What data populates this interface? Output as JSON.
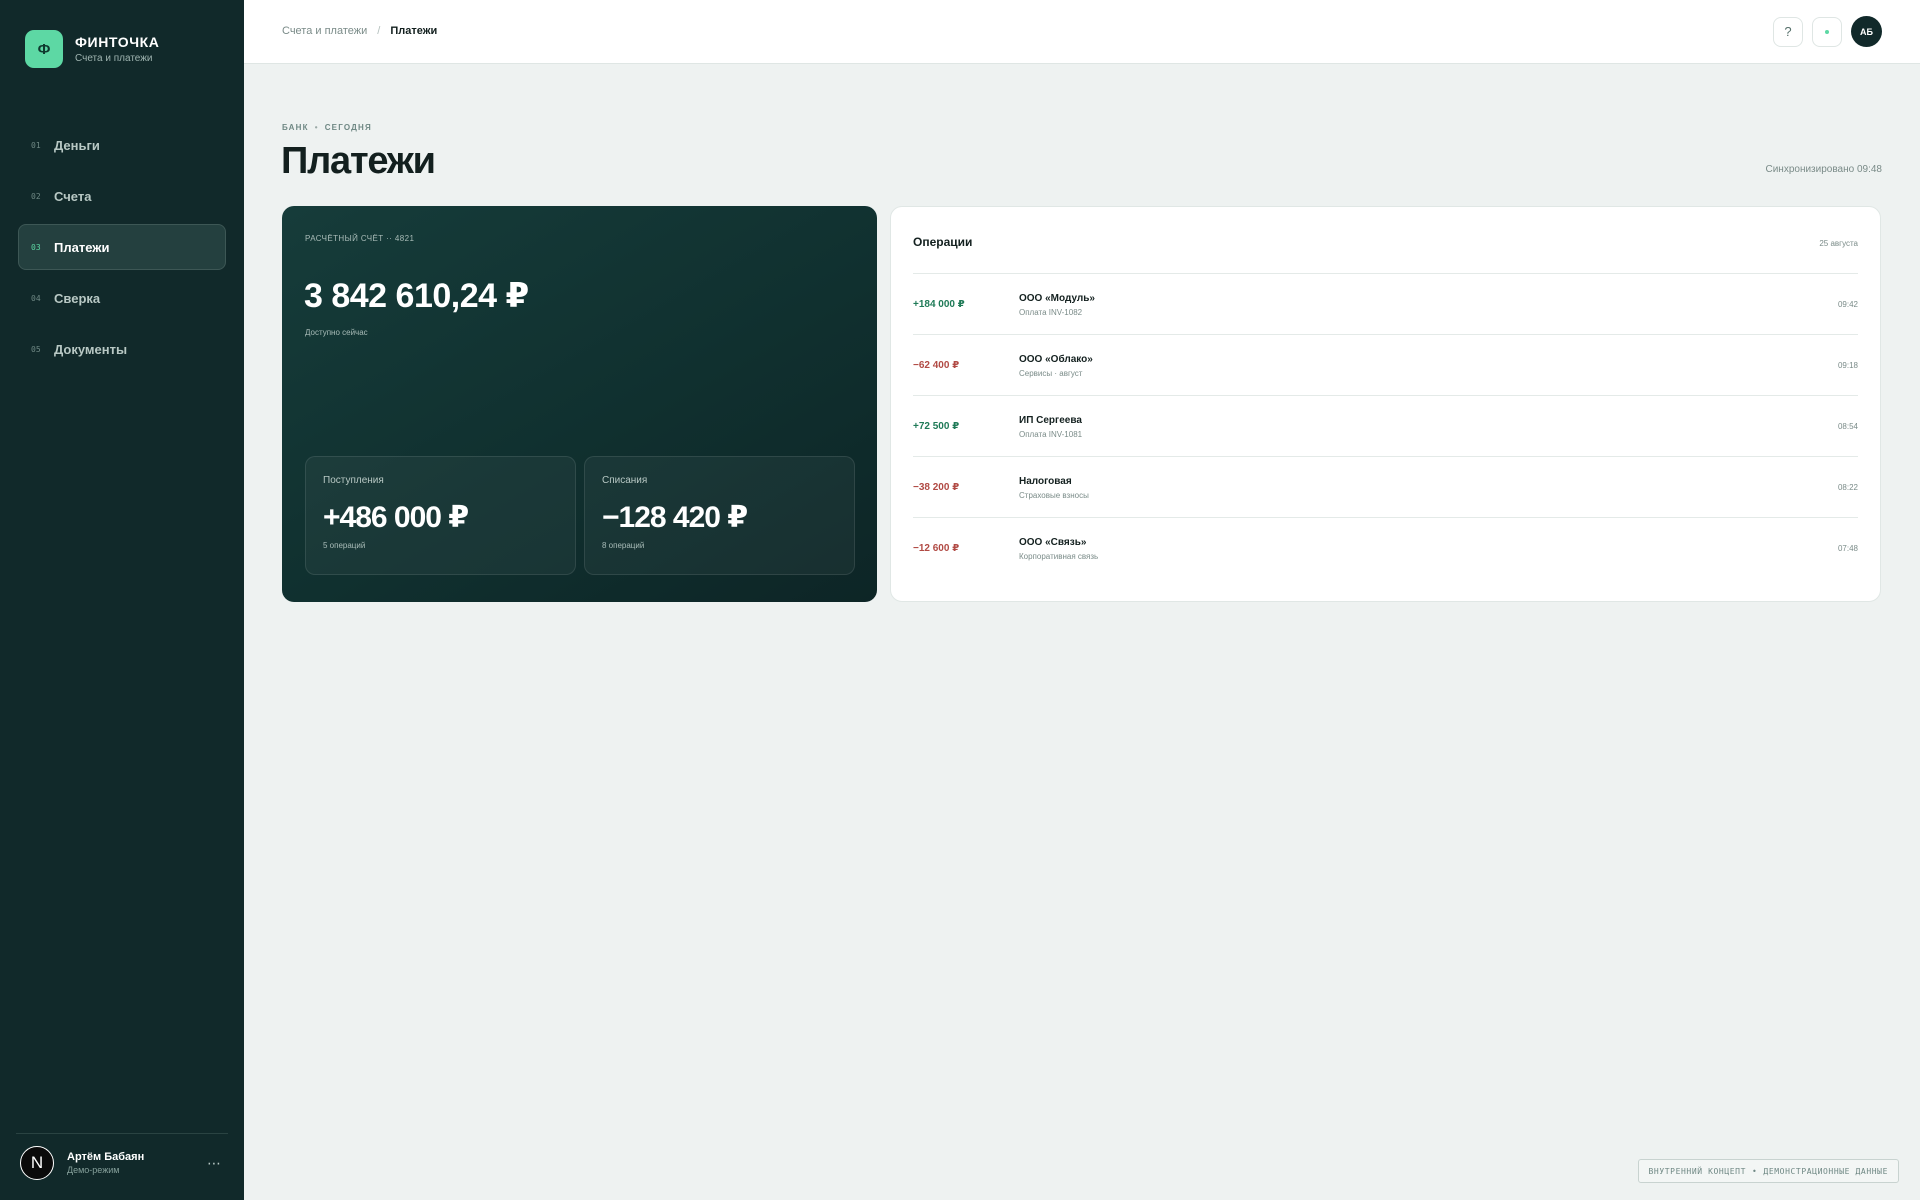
{
  "brand": {
    "logo_letter": "Ф",
    "name": "ФИНТОЧКА",
    "subtitle": "Счета и платежи"
  },
  "nav": {
    "items": [
      {
        "num": "01",
        "label": "Деньги",
        "active": false
      },
      {
        "num": "02",
        "label": "Счета",
        "active": false
      },
      {
        "num": "03",
        "label": "Платежи",
        "active": true
      },
      {
        "num": "04",
        "label": "Сверка",
        "active": false
      },
      {
        "num": "05",
        "label": "Документы",
        "active": false
      }
    ]
  },
  "user": {
    "avatar_letter": "N",
    "name": "Артём Бабаян",
    "role": "Демо-режим",
    "more": "⋯"
  },
  "topbar": {
    "breadcrumbs": [
      "Счета и платежи",
      "Платежи"
    ],
    "breadcrumb_sep": "/",
    "help_label": "?",
    "avatar_initials": "АБ"
  },
  "page": {
    "eyebrow": [
      "БАНК",
      "СЕГОДНЯ"
    ],
    "eyebrow_sep": "•",
    "title": "Платежи",
    "sync_status": "Синхронизировано 09:48"
  },
  "balance_card": {
    "account": "РАСЧЁТНЫЙ СЧЁТ ·· 4821",
    "amount": "3 842 610,24 ₽",
    "amount_caption": "Доступно сейчас",
    "income": {
      "label": "Поступления",
      "value": "+486 000 ₽",
      "count": "5 операций"
    },
    "expense": {
      "label": "Списания",
      "value": "−128 420 ₽",
      "count": "8 операций"
    }
  },
  "operations": {
    "title": "Операции",
    "date": "25 августа",
    "items": [
      {
        "amount": "+184 000 ₽",
        "direction": "in",
        "name": "ООО «Модуль»",
        "desc": "Оплата INV-1082",
        "time": "09:42"
      },
      {
        "amount": "−62 400 ₽",
        "direction": "out",
        "name": "ООО «Облако»",
        "desc": "Сервисы · август",
        "time": "09:18"
      },
      {
        "amount": "+72 500 ₽",
        "direction": "in",
        "name": "ИП Сергеева",
        "desc": "Оплата INV-1081",
        "time": "08:54"
      },
      {
        "amount": "−38 200 ₽",
        "direction": "out",
        "name": "Налоговая",
        "desc": "Страховые взносы",
        "time": "08:22"
      },
      {
        "amount": "−12 600 ₽",
        "direction": "out",
        "name": "ООО «Связь»",
        "desc": "Корпоративная связь",
        "time": "07:48"
      }
    ]
  },
  "footer_badge": {
    "parts": [
      "ВНУТРЕННИЙ КОНЦЕПТ",
      "ДЕМОНСТРАЦИОННЫЕ ДАННЫЕ"
    ],
    "sep": "•"
  },
  "colors": {
    "sidebar_bg": "#11292a",
    "accent": "#5dd8a4",
    "positive": "#1f7a57",
    "negative": "#b14a44",
    "page_bg": "#eef2f1"
  }
}
